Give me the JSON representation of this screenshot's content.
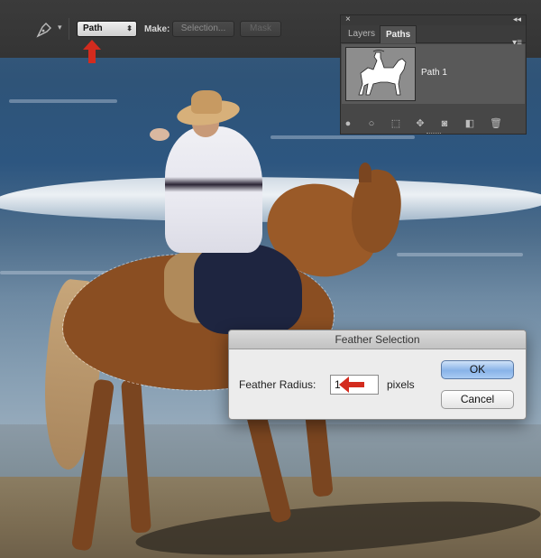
{
  "options_bar": {
    "tool_icon": "pen-tool-icon",
    "mode_value": "Path",
    "make_label": "Make:",
    "selection_button": "Selection...",
    "mask_button": "Mask",
    "annotation_color": "#d32b1e"
  },
  "paths_panel": {
    "tabs": [
      "Layers",
      "Paths"
    ],
    "active_tab": "Paths",
    "paths": [
      {
        "name": "Path 1"
      }
    ],
    "footer_icons": [
      "fill-path-icon",
      "stroke-path-icon",
      "load-as-selection-icon",
      "make-work-path-icon",
      "add-mask-icon",
      "new-path-icon",
      "trash-icon"
    ]
  },
  "feather_dialog": {
    "title": "Feather Selection",
    "radius_label": "Feather Radius:",
    "radius_value": "1",
    "unit_label": "pixels",
    "ok_label": "OK",
    "cancel_label": "Cancel"
  }
}
